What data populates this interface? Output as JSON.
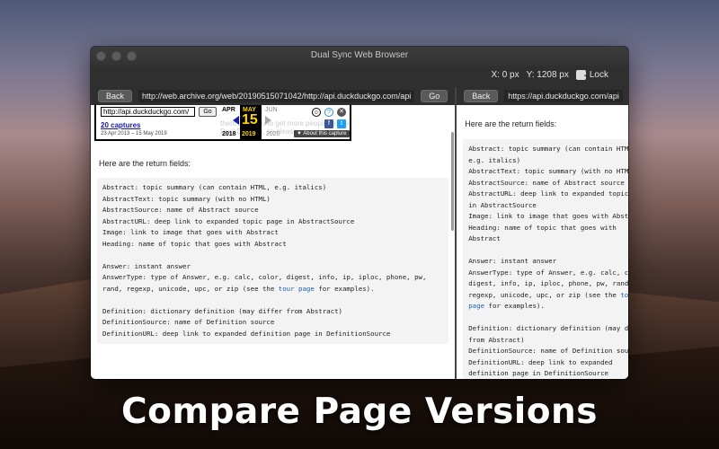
{
  "window": {
    "title": "Dual Sync Web Browser"
  },
  "toolbar": {
    "x_label": "X: 0 px",
    "y_label": "Y: 1208 px",
    "lock_label": "Lock",
    "lock_checked": true
  },
  "left": {
    "back_label": "Back",
    "url": "http://web.archive.org/web/20190515071042/http://api.duckduckgo.com/api",
    "go_label": "Go",
    "wayback": {
      "input_value": "http://api.duckduckgo.com/",
      "go_label": "Go",
      "captures": "20 captures",
      "range": "23 Apr 2013 – 15 May 2019",
      "month_prev": "APR",
      "month_cur": "MAY",
      "month_next": "JUN",
      "day": "15",
      "year_prev": "2018",
      "year_cur": "2019",
      "year_next": "2020",
      "about": "▼ About this capture",
      "underlying_text": "them in to you to get more people to use DuckDuckGo, so please"
    },
    "lead": "Here are the return fields:",
    "code_blocks": [
      "Abstract: topic summary (can contain HTML, e.g. italics)\nAbstractText: topic summary (with no HTML)\nAbstractSource: name of Abstract source\nAbstractURL: deep link to expanded topic page in AbstractSource\nImage: link to image that goes with Abstract\nHeading: name of topic that goes with Abstract\n\nAnswer: instant answer\nAnswerType: type of Answer, e.g. calc, color, digest, info, ip, iploc, phone, pw, rand, regexp, unicode, upc, or zip (see the ",
      " for examples).\n\nDefinition: dictionary definition (may differ from Abstract)\nDefinitionSource: name of Definition source\nDefinitionURL: deep link to expanded definition page in DefinitionSource"
    ],
    "code_link": "tour page"
  },
  "right": {
    "back_label": "Back",
    "url": "https://api.duckduckgo.com/api",
    "go_label": "Go",
    "lead": "Here are the return fields:",
    "code_blocks": [
      "Abstract: topic summary (can contain HTML, e.g. italics)\nAbstractText: topic summary (with no HTML)\nAbstractSource: name of Abstract source\nAbstractURL: deep link to expanded topic page in AbstractSource\nImage: link to image that goes with Abstract\nHeading: name of topic that goes with Abstract\n\nAnswer: instant answer\nAnswerType: type of Answer, e.g. calc, color, digest, info, ip, iploc, phone, pw, rand, regexp, unicode, upc, or zip (see the ",
      " for examples).\n\nDefinition: dictionary definition (may differ from Abstract)\nDefinitionSource: name of Definition source\nDefinitionURL: deep link to expanded definition page in DefinitionSource\n\nRelatedTopics: array of internal links to related topics associated with Abstract\n  Result: HTML link(s) to related topic(s)"
    ],
    "code_link": "tour page"
  },
  "caption": "Compare Page Versions",
  "colors": {
    "link": "#1a5fb4",
    "wayback_yellow": "#fbd600",
    "window_bg": "#2b2b2b"
  },
  "icons": [
    "archive-user-icon",
    "help-icon",
    "close-icon",
    "facebook-icon",
    "twitter-icon",
    "prev-arrow-icon",
    "next-arrow-icon",
    "checkmark-icon"
  ]
}
